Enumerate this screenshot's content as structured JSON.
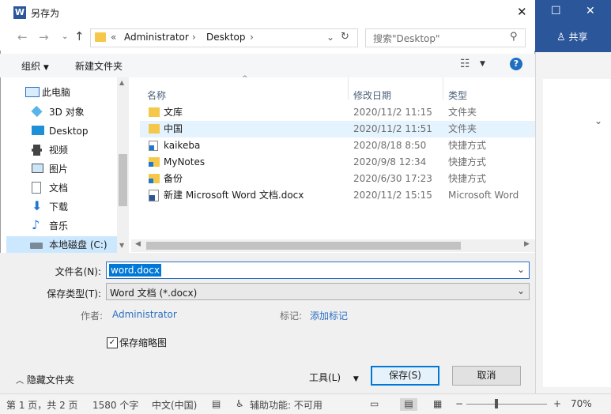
{
  "dialog": {
    "title": "另存为"
  },
  "nav": {
    "path_root": "«",
    "path": [
      "Administrator",
      "Desktop"
    ],
    "search_placeholder": "搜索\"Desktop\""
  },
  "toolbar": {
    "organize": "组织",
    "new_folder": "新建文件夹"
  },
  "sidebar": {
    "items": [
      {
        "label": "此电脑",
        "icon": "pc-icon"
      },
      {
        "label": "3D 对象",
        "icon": "3d-objects-icon"
      },
      {
        "label": "Desktop",
        "icon": "desktop-icon"
      },
      {
        "label": "视频",
        "icon": "video-icon"
      },
      {
        "label": "图片",
        "icon": "pictures-icon"
      },
      {
        "label": "文档",
        "icon": "documents-icon"
      },
      {
        "label": "下载",
        "icon": "download-icon"
      },
      {
        "label": "音乐",
        "icon": "music-icon"
      },
      {
        "label": "本地磁盘 (C:)",
        "icon": "drive-icon"
      }
    ]
  },
  "columns": {
    "name": "名称",
    "modified": "修改日期",
    "type": "类型"
  },
  "files": [
    {
      "name": "文库",
      "date": "2020/11/2 11:15",
      "type": "文件夹",
      "icon": "folder-icon"
    },
    {
      "name": "中国",
      "date": "2020/11/2 11:51",
      "type": "文件夹",
      "icon": "folder-icon"
    },
    {
      "name": "kaikeba",
      "date": "2020/8/18 8:50",
      "type": "快捷方式",
      "icon": "shortcut-icon"
    },
    {
      "name": "MyNotes",
      "date": "2020/9/8 12:34",
      "type": "快捷方式",
      "icon": "shortcut-icon"
    },
    {
      "name": "备份",
      "date": "2020/6/30 17:23",
      "type": "快捷方式",
      "icon": "shortcut-icon"
    },
    {
      "name": "新建 Microsoft Word 文档.docx",
      "date": "2020/11/2 15:15",
      "type": "Microsoft Word",
      "icon": "word-doc-icon"
    }
  ],
  "form": {
    "filename_label": "文件名(N):",
    "filename_value": "word.docx",
    "filetype_label": "保存类型(T):",
    "filetype_value": "Word 文档 (*.docx)",
    "author_label": "作者:",
    "author_value": "Administrator",
    "tags_label": "标记:",
    "tags_value": "添加标记",
    "thumbnail_label": "保存缩略图",
    "thumbnail_checked": true
  },
  "footer": {
    "hide_folders": "隐藏文件夹",
    "tools": "工具(L)",
    "save": "保存(S)",
    "cancel": "取消"
  },
  "word": {
    "share": "共享"
  },
  "statusbar": {
    "page": "第 1 页，共 2 页",
    "words": "1580 个字",
    "language": "中文(中国)",
    "accessibility": "辅助功能: 不可用",
    "zoom": "70%"
  },
  "colors": {
    "word_blue": "#2b579a",
    "link": "#2a6ec4",
    "selection": "#e5f3ff",
    "filename_highlight": "#0078d7"
  }
}
